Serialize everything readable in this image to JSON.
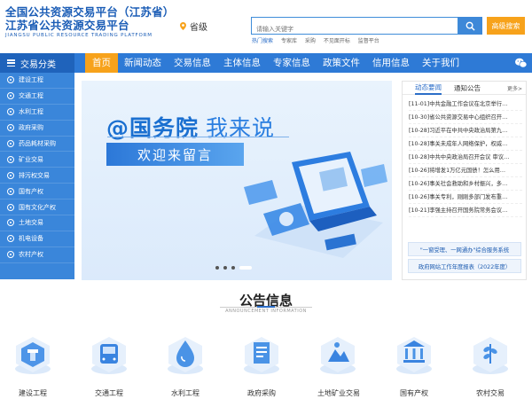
{
  "header": {
    "title_line1": "全国公共资源交易平台（江苏省）",
    "title_line2": "江苏省公共资源交易平台",
    "title_en": "JIANGSU PUBLIC RESOURCE TRADING PLATFORM",
    "region": "省级",
    "search_placeholder": "请输入关键字",
    "advanced_search": "高级搜索",
    "hot_label": "热门搜索",
    "hot_words": [
      "专家库",
      "采购",
      "不见面开标",
      "监督平台"
    ]
  },
  "nav": {
    "category_label": "交易分类",
    "items": [
      "首页",
      "新闻动态",
      "交易信息",
      "主体信息",
      "专家信息",
      "政策文件",
      "信用信息",
      "关于我们"
    ]
  },
  "sidebar": {
    "items": [
      "建设工程",
      "交通工程",
      "水利工程",
      "政府采购",
      "药品耗材采购",
      "矿业交易",
      "排污权交易",
      "国有产权",
      "国有文化产权",
      "土地交易",
      "机电设备",
      "农村产权"
    ]
  },
  "banner": {
    "title_main": "@国务院",
    "title_sub": "我来说",
    "subtitle": "欢迎来留言"
  },
  "news": {
    "tabs": [
      "动态要闻",
      "通知公告"
    ],
    "more": "更多>",
    "items": [
      "[11-01]中共金融工作会议在北京举行…",
      "[10-30]省公共资源交易中心组织召开…",
      "[10-28]习近平在中共中央政治局第九…",
      "[10-28]事关未成年人网络保护，权威…",
      "[10-28]中共中央政治局召开会议 审议…",
      "[10-26]将增发1万亿元国债！怎么用…",
      "[10-26]事关社会救助和乡村振兴，多…",
      "[10-26]事关专利，刚刚多部门发布重…",
      "[10-21]李强主持召开国务院常务会议…"
    ],
    "button1": "\"一窗受理、一网通办\"综合服务系统",
    "button2": "政府网站工作年度报表（2022年度）"
  },
  "announcement": {
    "title": "公告信息",
    "subtitle": "ANNOUNCEMENT INFORMATION"
  },
  "categories": [
    {
      "label": "建设工程",
      "icon": "construction-icon"
    },
    {
      "label": "交通工程",
      "icon": "bus-icon"
    },
    {
      "label": "水利工程",
      "icon": "water-drop-icon"
    },
    {
      "label": "政府采购",
      "icon": "document-icon"
    },
    {
      "label": "土地矿业交易",
      "icon": "mining-icon"
    },
    {
      "label": "国有产权",
      "icon": "bank-icon"
    },
    {
      "label": "农村交易",
      "icon": "crop-icon"
    }
  ],
  "colors": {
    "primary": "#2e7ad6",
    "accent": "#f7a21b",
    "sidebar": "#3a86da"
  }
}
